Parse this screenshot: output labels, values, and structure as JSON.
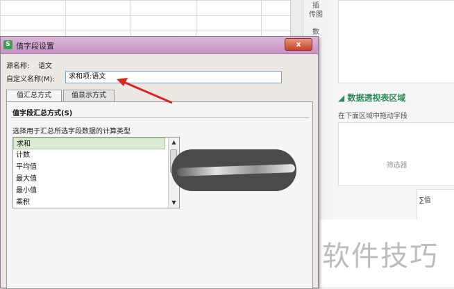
{
  "background": {
    "toolbar_labels": [
      "插\n传图",
      "数"
    ],
    "panel_section_title": "数据透视表区域",
    "panel_instruction": "在下面区域中拖动字段",
    "filter_label": "筛选器",
    "values_label": "∑值",
    "watermark": "软件技巧"
  },
  "dialog": {
    "title": "值字段设置",
    "close_label": "x",
    "source_name_label": "源名称:",
    "source_name_value": "语文",
    "custom_name_label": "自定义名称(M):",
    "custom_name_value": "求和项:语文",
    "tabs": [
      {
        "label": "值汇总方式"
      },
      {
        "label": "值显示方式"
      }
    ],
    "section_title": "值字段汇总方式(S)",
    "hint": "选择用于汇总所选字段数据的计算类型",
    "functions": [
      "求和",
      "计数",
      "平均值",
      "最大值",
      "最小值",
      "乘积"
    ],
    "selected_function": "求和"
  },
  "colors": {
    "accent_green": "#2e8b57",
    "arrow_red": "#e0221f",
    "titlebar": "#c792c4"
  }
}
